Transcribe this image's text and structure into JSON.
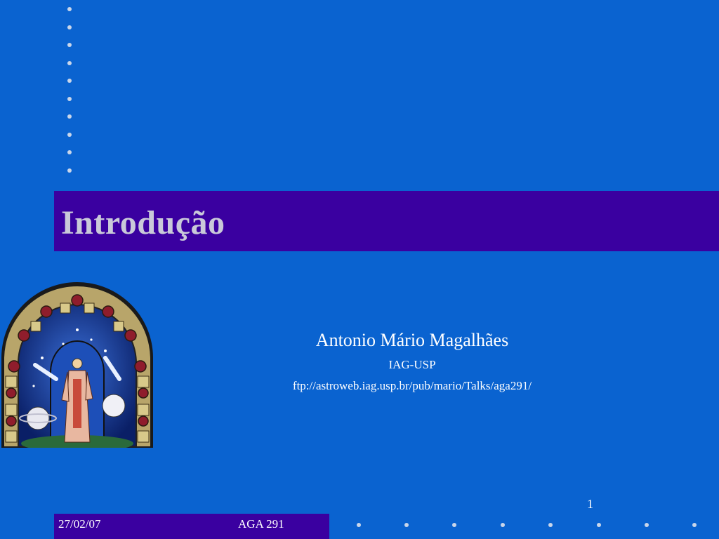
{
  "slide": {
    "title": "Introdução",
    "author": "Antonio Mário Magalhães",
    "affiliation": "IAG-USP",
    "url": "ftp://astroweb.iag.usp.br/pub/mario/Talks/aga291/",
    "page_number": "1"
  },
  "footer": {
    "date": "27/02/07",
    "course": "AGA 291"
  },
  "colors": {
    "background": "#0a63d0",
    "title_bar": "#3a00a0",
    "dots": "#c9d6ea"
  },
  "decorations": {
    "image": "stained-glass-window-zodiac",
    "dot_pattern": "bullet-dots"
  }
}
